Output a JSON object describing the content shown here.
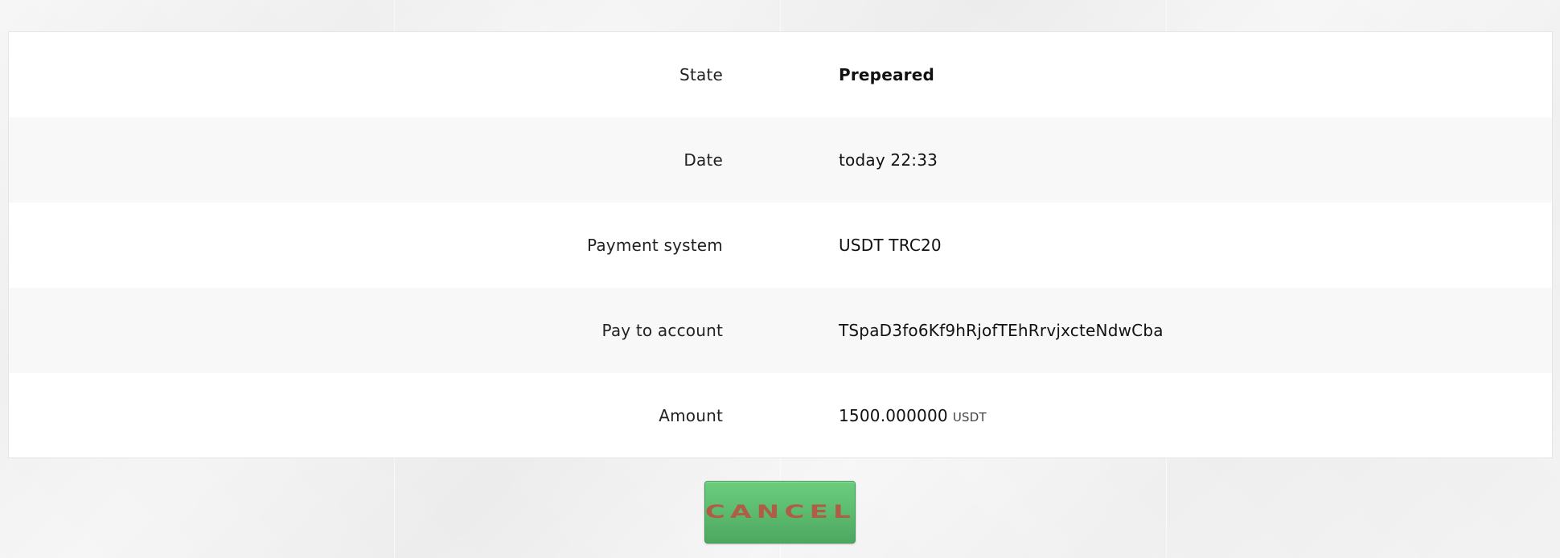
{
  "details": {
    "rows": [
      {
        "label": "State",
        "value": "Prepeared"
      },
      {
        "label": "Date",
        "value": "today 22:33"
      },
      {
        "label": "Payment system",
        "value": "USDT TRC20"
      },
      {
        "label": "Pay to account",
        "value": "TSpaD3fo6Kf9hRjofTEhRrvjxcteNdwCba"
      },
      {
        "label": "Amount",
        "value": "1500.000000",
        "unit": "USDT"
      }
    ]
  },
  "actions": {
    "cancel_label": "CANCEL"
  },
  "colors": {
    "button_green": "#5dbd70",
    "button_text": "#b05d47",
    "row_alt": "#f8f8f8"
  }
}
